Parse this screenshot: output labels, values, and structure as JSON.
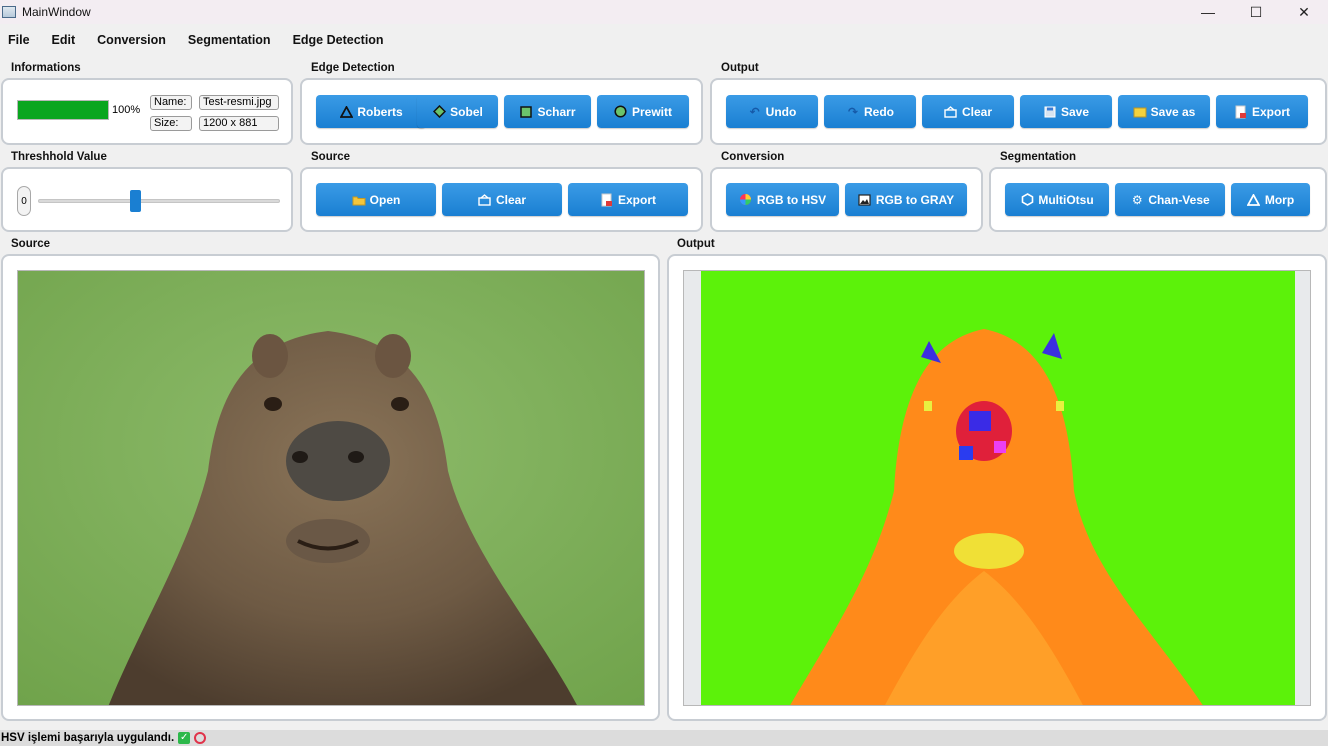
{
  "window": {
    "title": "MainWindow",
    "minimize": "—",
    "maximize": "☐",
    "close": "✕"
  },
  "menu": [
    "File",
    "Edit",
    "Conversion",
    "Segmentation",
    "Edge Detection"
  ],
  "informations": {
    "title": "Informations",
    "progress_percent": 100,
    "progress_text": "100%",
    "name_label": "Name:",
    "name_value": "Test-resmi.jpg",
    "size_label": "Size:",
    "size_value": "1200 x 881"
  },
  "edge_detection": {
    "title": "Edge Detection",
    "buttons": [
      "Roberts",
      "Sobel",
      "Scharr",
      "Prewitt"
    ]
  },
  "output_tools": {
    "title": "Output",
    "buttons": [
      "Undo",
      "Redo",
      "Clear",
      "Save",
      "Save as",
      "Export"
    ]
  },
  "threshold": {
    "title": "Threshhold Value",
    "value": "0",
    "slider_fraction": 0.4
  },
  "source_tools": {
    "title": "Source",
    "buttons": [
      "Open",
      "Clear",
      "Export"
    ]
  },
  "conversion": {
    "title": "Conversion",
    "buttons": [
      "RGB to HSV",
      "RGB to GRAY"
    ]
  },
  "segmentation": {
    "title": "Segmentation",
    "buttons": [
      "MultiOtsu",
      "Chan-Vese",
      "Morp"
    ]
  },
  "source_view": {
    "title": "Source"
  },
  "output_view": {
    "title": "Output"
  },
  "status": {
    "message": "HSV işlemi başarıyla uygulandı."
  },
  "colors": {
    "button": "#1a7fd2",
    "progress": "#0aa61f",
    "hsv_background": "#5cf20a",
    "hsv_subject": "#ff8a1a"
  }
}
